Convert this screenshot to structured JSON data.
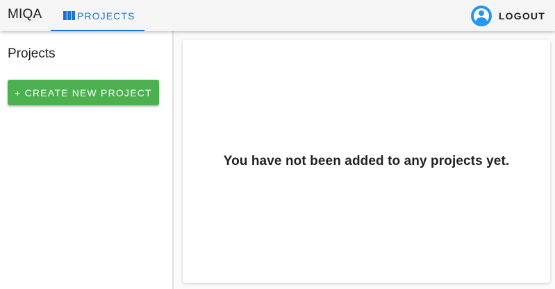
{
  "app": {
    "brand": "MIQA"
  },
  "nav": {
    "tabs": [
      {
        "label": "Projects",
        "icon": "view-column-icon",
        "active": true
      }
    ]
  },
  "user": {
    "avatar_icon": "account-circle-icon",
    "logout_label": "Logout"
  },
  "sidebar": {
    "title": "Projects",
    "create_button_label": "+ Create new project"
  },
  "main": {
    "empty_message": "You have not been added to any projects yet."
  },
  "colors": {
    "primary": "#1976d2",
    "success": "#4caf50",
    "avatar": "#2196f3",
    "appbar": "#f5f5f5"
  }
}
